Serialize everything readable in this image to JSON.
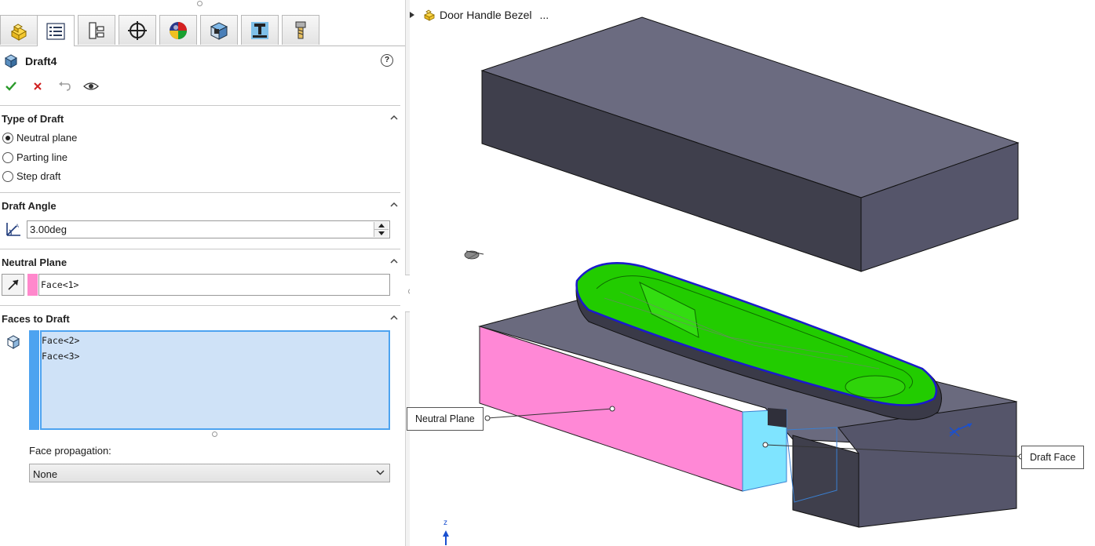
{
  "tabs": [
    {
      "name": "tab-feature-manager",
      "icon": "part-icon"
    },
    {
      "name": "tab-property-manager",
      "icon": "property-manager-icon"
    },
    {
      "name": "tab-configuration-manager",
      "icon": "configuration-icon"
    },
    {
      "name": "tab-dimxpert-manager",
      "icon": "target-icon"
    },
    {
      "name": "tab-display-manager",
      "icon": "color-wheel-icon"
    },
    {
      "name": "tab-cam-feature",
      "icon": "cube-view-icon"
    },
    {
      "name": "tab-cam-operation",
      "icon": "mill-tool-icon"
    },
    {
      "name": "tab-cam-tools",
      "icon": "drill-tool-icon"
    }
  ],
  "feature": {
    "title": "Draft4",
    "help_icon": "?"
  },
  "sections": {
    "type_of_draft": {
      "label": "Type of Draft",
      "options": [
        "Neutral plane",
        "Parting line",
        "Step draft"
      ],
      "selected": "Neutral plane"
    },
    "draft_angle": {
      "label": "Draft Angle",
      "value": "3.00deg"
    },
    "neutral_plane": {
      "label": "Neutral Plane",
      "value": "Face<1>",
      "swatch_color": "#ff88cc"
    },
    "faces_to_draft": {
      "label": "Faces to Draft",
      "items": [
        "Face<2>",
        "Face<3>"
      ],
      "swatch_color": "#4da3f0",
      "list_bg": "#cfe2f7"
    },
    "face_propagation": {
      "label": "Face propagation:",
      "value": "None"
    }
  },
  "viewport": {
    "tree_label": "Door Handle Bezel",
    "tree_ellipsis": "...",
    "callout_neutral": "Neutral Plane",
    "callout_draft": "Draft Face",
    "axis_label": "z",
    "colors": {
      "block_top": "#6b6b80",
      "block_front": "#3f3f4c",
      "block_side": "#55556a",
      "neutral_face": "#ff88d6",
      "draft_face": "#7fe4ff",
      "green_surface": "#22cc00",
      "edge_blue": "#1a1acc"
    }
  }
}
